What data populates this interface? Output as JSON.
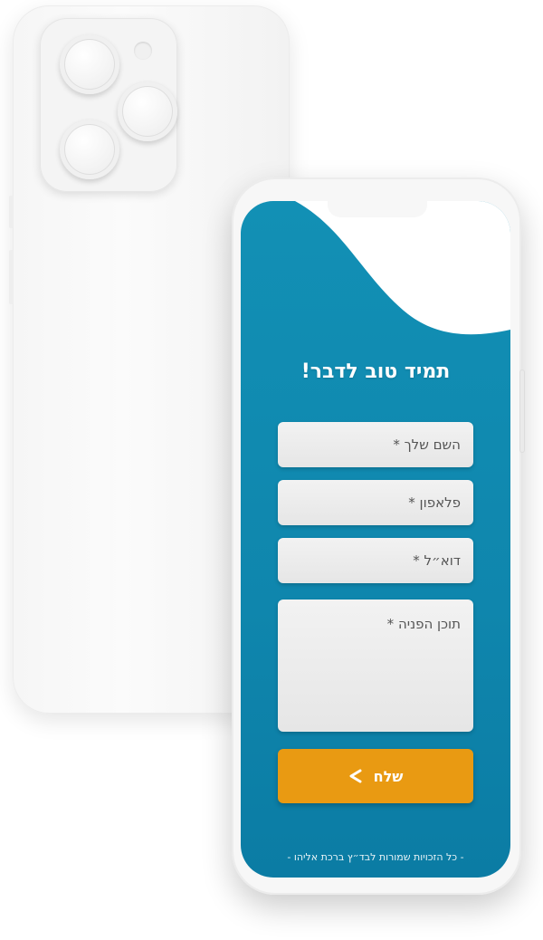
{
  "form": {
    "title": "תמיד טוב לדבר!",
    "fields": {
      "name_placeholder": "השם שלך *",
      "phone_placeholder": "פלאפון *",
      "email_placeholder": "דוא״ל *",
      "message_placeholder": "תוכן הפניה *"
    },
    "send_label": "שלח",
    "footer": "- כל הזכויות שמורות לבד״ץ ברכת אליהו -"
  },
  "colors": {
    "screen_blue": "#1290b5",
    "button_orange": "#e99a12",
    "field_bg": "#ececec"
  },
  "icons": {
    "send_icon": "chevron-left-icon"
  }
}
